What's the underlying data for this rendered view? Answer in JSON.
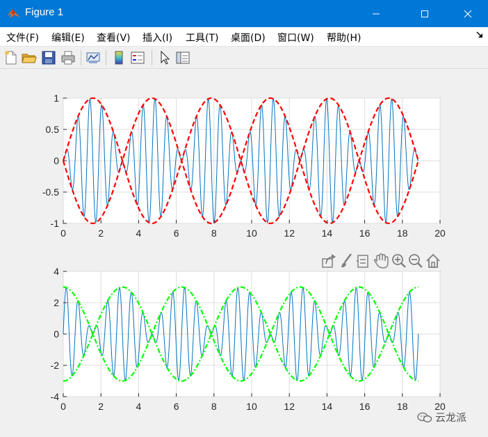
{
  "window": {
    "title": "Figure 1"
  },
  "menu": {
    "items": [
      "文件(F)",
      "编辑(E)",
      "查看(V)",
      "插入(I)",
      "工具(T)",
      "桌面(D)",
      "窗口(W)",
      "帮助(H)"
    ]
  },
  "toolbar": {
    "icons": [
      "new-file-icon",
      "open-folder-icon",
      "save-icon",
      "print-icon",
      "link-plot-icon",
      "colorbar-icon",
      "legend-icon",
      "pointer-icon",
      "property-editor-icon"
    ]
  },
  "axes_toolbar": {
    "icons": [
      "export-icon",
      "brush-icon",
      "datatip-icon",
      "pan-icon",
      "zoom-in-icon",
      "zoom-out-icon",
      "home-icon"
    ]
  },
  "watermark": {
    "text": "云龙派"
  },
  "colors": {
    "titlebar": "#0078d7",
    "signal": "#0072bd",
    "envelope_top": "#ff0000",
    "envelope_bottom": "#00ff00"
  },
  "chart_data": [
    {
      "type": "line",
      "xlim": [
        0,
        20
      ],
      "ylim": [
        -1,
        1
      ],
      "xticks": [
        "0",
        "2",
        "4",
        "6",
        "8",
        "10",
        "12",
        "14",
        "16",
        "18",
        "20"
      ],
      "yticks": [
        "-1",
        "-0.5",
        "0",
        "0.5",
        "1"
      ],
      "grid": true,
      "series": [
        {
          "x_range": [
            0,
            18.85
          ],
          "expression": "sin(x)*sin(10x)",
          "color": "#0072bd",
          "style": "solid"
        },
        {
          "x_range": [
            0,
            18.85
          ],
          "expression": "sin(x)",
          "color": "#ff0000",
          "style": "dashed"
        },
        {
          "x_range": [
            0,
            18.85
          ],
          "expression": "-sin(x)",
          "color": "#ff0000",
          "style": "dashed"
        }
      ]
    },
    {
      "type": "line",
      "xlim": [
        0,
        20
      ],
      "ylim": [
        -4,
        4
      ],
      "xticks": [
        "0",
        "2",
        "4",
        "6",
        "8",
        "10",
        "12",
        "14",
        "16",
        "18",
        "20"
      ],
      "yticks": [
        "-4",
        "-2",
        "0",
        "2",
        "4"
      ],
      "grid": true,
      "series": [
        {
          "x_range": [
            0,
            18.85
          ],
          "expression": "3cos(x)*sin(10x)",
          "color": "#0072bd",
          "style": "solid"
        },
        {
          "x_range": [
            0,
            18.85
          ],
          "expression": "3cos(x)",
          "color": "#00ff00",
          "style": "dashdot"
        },
        {
          "x_range": [
            0,
            18.85
          ],
          "expression": "-3cos(x)",
          "color": "#00ff00",
          "style": "dashdot"
        }
      ]
    }
  ]
}
